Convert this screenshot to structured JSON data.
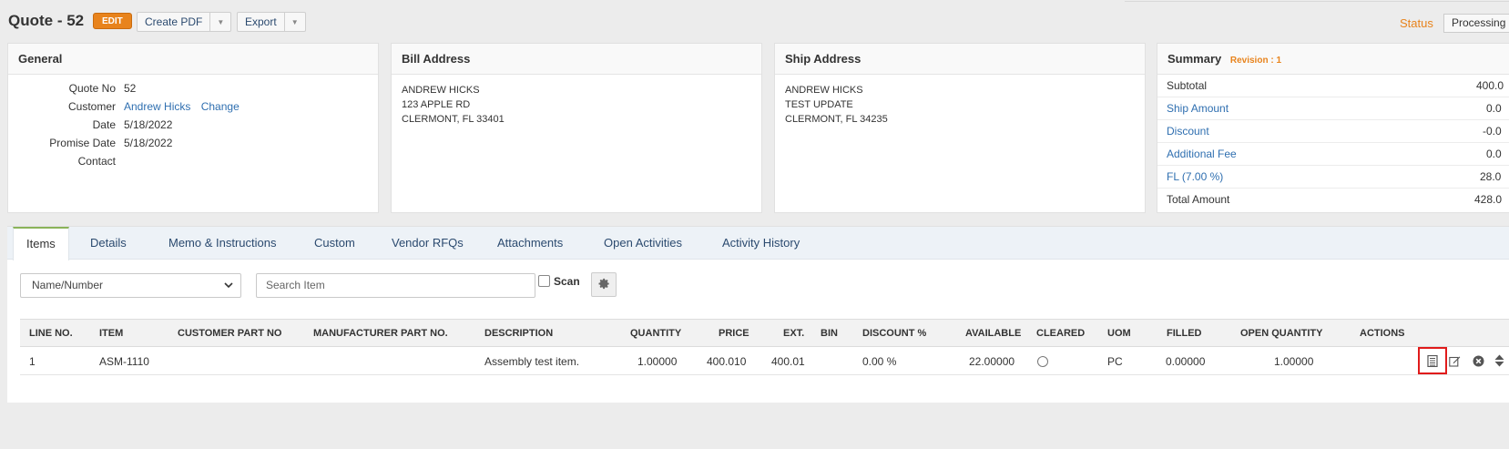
{
  "header": {
    "title": "Quote - 52",
    "edit_label": "EDIT",
    "create_pdf_label": "Create PDF",
    "export_label": "Export",
    "status_label": "Status",
    "status_value": "Processing"
  },
  "general": {
    "title": "General",
    "quote_no_label": "Quote No",
    "quote_no": "52",
    "customer_label": "Customer",
    "customer": "Andrew Hicks",
    "change_label": "Change",
    "date_label": "Date",
    "date": "5/18/2022",
    "promise_date_label": "Promise Date",
    "promise_date": "5/18/2022",
    "contact_label": "Contact",
    "contact": ""
  },
  "bill_address": {
    "title": "Bill Address",
    "line1": "ANDREW HICKS",
    "line2": "123 APPLE RD",
    "line3": "CLERMONT, FL 33401"
  },
  "ship_address": {
    "title": "Ship Address",
    "line1": "ANDREW HICKS",
    "line2": "TEST UPDATE",
    "line3": "CLERMONT, FL 34235"
  },
  "summary": {
    "title": "Summary",
    "revision": "Revision : 1",
    "rows": [
      {
        "label": "Subtotal",
        "amount": "400.0"
      },
      {
        "label": "Ship Amount",
        "amount": "0.0"
      },
      {
        "label": "Discount",
        "amount": "-0.0"
      },
      {
        "label": "Additional Fee",
        "amount": "0.0"
      },
      {
        "label": "FL (7.00 %)",
        "amount": "28.0"
      },
      {
        "label": "Total Amount",
        "amount": "428.0"
      }
    ]
  },
  "tabs": [
    {
      "label": "Items"
    },
    {
      "label": "Details"
    },
    {
      "label": "Memo & Instructions"
    },
    {
      "label": "Custom"
    },
    {
      "label": "Vendor RFQs"
    },
    {
      "label": "Attachments"
    },
    {
      "label": "Open Activities"
    },
    {
      "label": "Activity History"
    }
  ],
  "filter": {
    "selected": "Name/Number",
    "search_placeholder": "Search Item",
    "scan_label": "Scan"
  },
  "grid": {
    "columns": [
      "LINE NO.",
      "ITEM",
      "CUSTOMER PART NO",
      "MANUFACTURER PART NO.",
      "DESCRIPTION",
      "QUANTITY",
      "PRICE",
      "EXT.",
      "BIN",
      "DISCOUNT %",
      "AVAILABLE",
      "CLEARED",
      "UOM",
      "FILLED",
      "OPEN QUANTITY",
      "ACTIONS"
    ],
    "rows": [
      {
        "line_no": "1",
        "item": "ASM-1110",
        "customer_part_no": "",
        "manufacturer_part_no": "",
        "description": "Assembly test item.",
        "quantity": "1.00000",
        "price": "400.010",
        "ext": "400.01",
        "bin": "",
        "discount": "0.00 %",
        "available": "22.00000",
        "uom": "PC",
        "filled": "0.00000",
        "open_quantity": "1.00000"
      }
    ]
  },
  "icons": {
    "view": "list-view-icon",
    "edit": "edit-icon",
    "delete": "remove-circle-icon",
    "reorder": "sort-arrows-icon",
    "gear": "gear-icon"
  },
  "colors": {
    "accent": "#e8831c",
    "link": "#2f6fb0",
    "highlight": "#e01b1b"
  }
}
